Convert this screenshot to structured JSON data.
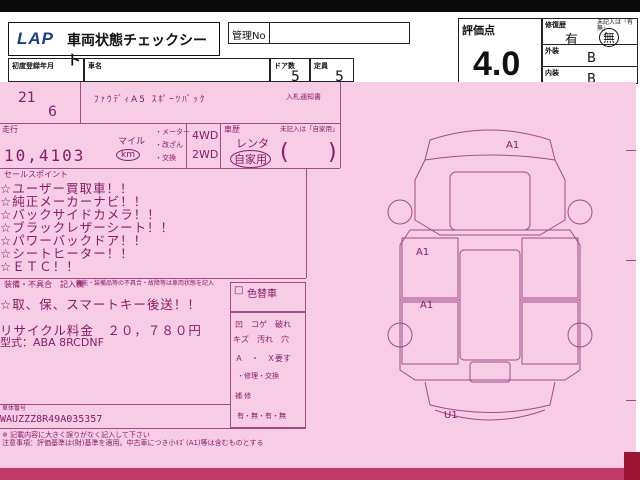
{
  "header": {
    "logo": "LAP",
    "title": "車両状態チェックシート",
    "kanri_label": "管理No",
    "kanri_value": ""
  },
  "evaluation": {
    "label": "評価点",
    "value": "4.0"
  },
  "right_panel": {
    "repair_label": "修復歴",
    "repair_value": "有",
    "repair_none": "無",
    "unrecorded": "未記入は「有無」",
    "exterior_label": "外装",
    "exterior_value": "B",
    "interior_label": "内装",
    "interior_value": "B"
  },
  "registration": {
    "first_reg_label": "初度登録年月",
    "model_label": "車名",
    "doors_label": "ドア数",
    "doors_value": "5",
    "capacity_label": "定員",
    "capacity_value": "5",
    "year": "21",
    "month": "6",
    "model_partial": "ﾌｧｳﾃﾞｨA5 ｽﾎﾟｰﾂﾊﾞｯｸ",
    "auction_label": "入札通知書"
  },
  "mileage": {
    "label": "走行",
    "unit_top": "マイル",
    "value": "10,4103",
    "unit": "km",
    "note1": "・メーター",
    "note2": "・改ざん",
    "note3": "・交換",
    "drive_4wd": "4WD",
    "drive_2wd": "2WD",
    "usage_label": "車歴",
    "usage_rental": "レンタ",
    "usage_private": "自家用",
    "usage_unrecorded": "未記入は「自家用」"
  },
  "selling_points": {
    "label": "セールスポイント",
    "items": [
      "☆ユーザー買取車！！",
      "☆純正メーカーナビ！！",
      "☆バックサイドカメラ！！",
      "☆ブラックレザーシート！！",
      "☆パワーバックドア！！",
      "☆シートヒーター！！",
      "☆ＥＴＣ！！"
    ]
  },
  "notes": {
    "label": "装備・不具合　記入欄",
    "label_sub": "機能・装備品等の不具合・故障等は車両状態を記入",
    "line1": "☆取、保、スマートキー後送！！",
    "line2": "リサイクル料金　２０，７８０円",
    "line3": "型式：ABA 8RCDNF",
    "color_change": "色替車"
  },
  "defect_legend": {
    "row1": "凹　コゲ　破れ",
    "row2": "キズ　汚れ　穴",
    "row3": "Ａ　・　Ｘ要す",
    "row4": "・修理・交換",
    "row5": "補  修",
    "row6": "有・無・有・無"
  },
  "diagram": {
    "marks": [
      "A1",
      "A1",
      "A1",
      "U1"
    ]
  },
  "chassis": {
    "label": "車体番号",
    "value": "WAUZZZ8R49A035357"
  },
  "footer": {
    "note1": "※ 記載内容に大きく誤りがなく記入して下さい",
    "note2": "注意事項：評価基準は(財)基準を適用。中古車につき小ｷｽﾞ(A1)等は含むものとする"
  }
}
